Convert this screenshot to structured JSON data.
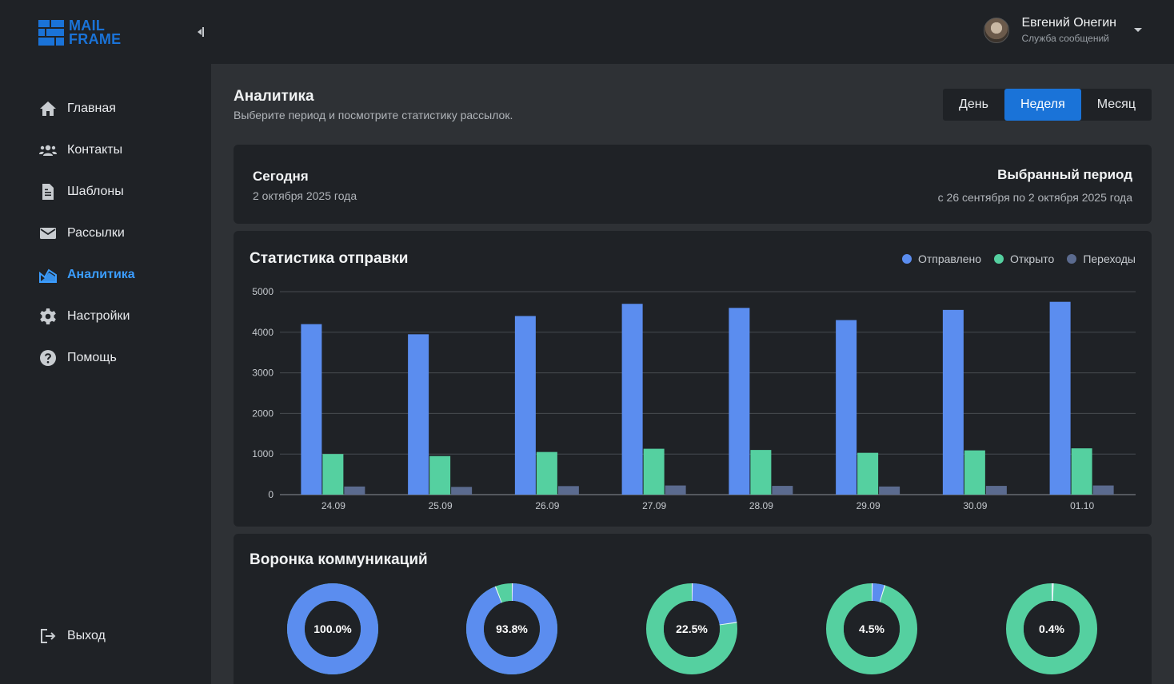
{
  "brand": {
    "line1": "MAIL",
    "line2": "FRAME",
    "color": "#1a73d8"
  },
  "user": {
    "name": "Евгений Онегин",
    "role": "Служба сообщений"
  },
  "sidebar": {
    "items": [
      {
        "label": "Главная",
        "icon": "home-icon"
      },
      {
        "label": "Контакты",
        "icon": "contacts-icon"
      },
      {
        "label": "Шаблоны",
        "icon": "document-icon"
      },
      {
        "label": "Рассылки",
        "icon": "mail-icon"
      },
      {
        "label": "Аналитика",
        "icon": "analytics-icon",
        "active": true
      },
      {
        "label": "Настройки",
        "icon": "gear-icon"
      },
      {
        "label": "Помощь",
        "icon": "help-icon"
      }
    ],
    "logout": {
      "label": "Выход",
      "icon": "logout-icon"
    }
  },
  "header": {
    "title": "Аналитика",
    "subtitle": "Выберите период и посмотрите статистику рассылок.",
    "periods": [
      "День",
      "Неделя",
      "Месяц"
    ],
    "active_period": "Неделя"
  },
  "dates": {
    "today_label": "Сегодня",
    "today_value": "2 октября 2025 года",
    "period_label": "Выбранный период",
    "period_value": "с 26 сентября по 2 октября 2025 года"
  },
  "chart_data": {
    "type": "bar",
    "title": "Статистика отправки",
    "categories": [
      "24.09",
      "25.09",
      "26.09",
      "27.09",
      "28.09",
      "29.09",
      "30.09",
      "01.10"
    ],
    "series": [
      {
        "name": "Отправлено",
        "color": "#5b8def",
        "values": [
          4200,
          3950,
          4400,
          4700,
          4600,
          4300,
          4550,
          4750
        ]
      },
      {
        "name": "Открыто",
        "color": "#55d0a0",
        "values": [
          1000,
          950,
          1050,
          1130,
          1100,
          1030,
          1090,
          1140
        ]
      },
      {
        "name": "Переходы",
        "color": "#5b6b8f",
        "values": [
          200,
          190,
          210,
          225,
          215,
          200,
          215,
          225
        ]
      }
    ],
    "ylim": [
      0,
      5000
    ],
    "yticks": [
      0,
      1000,
      2000,
      3000,
      4000,
      5000
    ],
    "grid": true,
    "legend": "top-right"
  },
  "funnel": {
    "title": "Воронка коммуникаций",
    "items": [
      {
        "label": "100.0%",
        "value": 100.0
      },
      {
        "label": "93.8%",
        "value": 93.8
      },
      {
        "label": "22.5%",
        "value": 22.5
      },
      {
        "label": "4.5%",
        "value": 4.5
      },
      {
        "label": "0.4%",
        "value": 0.4
      }
    ],
    "colors": {
      "filled": "#5b8def",
      "rest": "#55d0a0"
    }
  }
}
